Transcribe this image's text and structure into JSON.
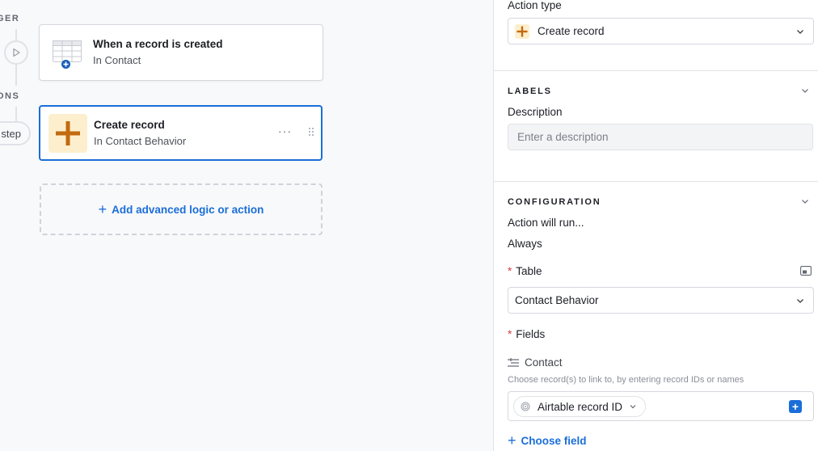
{
  "canvas": {
    "trigger_section_label": "GER",
    "actions_section_label": "ONS",
    "step_pill_label": "step",
    "trigger_card": {
      "title": "When a record is created",
      "subtitle": "In Contact"
    },
    "action_card": {
      "title": "Create record",
      "subtitle": "In Contact Behavior",
      "more_label": "···"
    },
    "add_action_label": "Add advanced logic or action",
    "add_action_glyph": "+"
  },
  "panel": {
    "action_type": {
      "label": "Action type",
      "value": "Create record",
      "icon": "plus-icon"
    },
    "labels_section": {
      "heading": "LABELS",
      "description_label": "Description",
      "description_placeholder": "Enter a description"
    },
    "configuration_section": {
      "heading": "CONFIGURATION",
      "runs_label": "Action will run...",
      "runs_value": "Always",
      "required_marker": "*",
      "table_label": "Table",
      "table_value": "Contact Behavior",
      "fields_label": "Fields",
      "contact_field": {
        "label": "Contact",
        "hint": "Choose record(s) to link to, by entering record IDs or names",
        "mode_value": "Airtable record ID",
        "add_glyph": "+"
      },
      "choose_field_label": "Choose field",
      "choose_field_glyph": "+"
    }
  },
  "colors": {
    "accent_blue": "#1a6ed8",
    "action_icon_bg": "#fdefcd",
    "action_icon_fg": "#c26a0f",
    "required_red": "#d93a3a"
  }
}
